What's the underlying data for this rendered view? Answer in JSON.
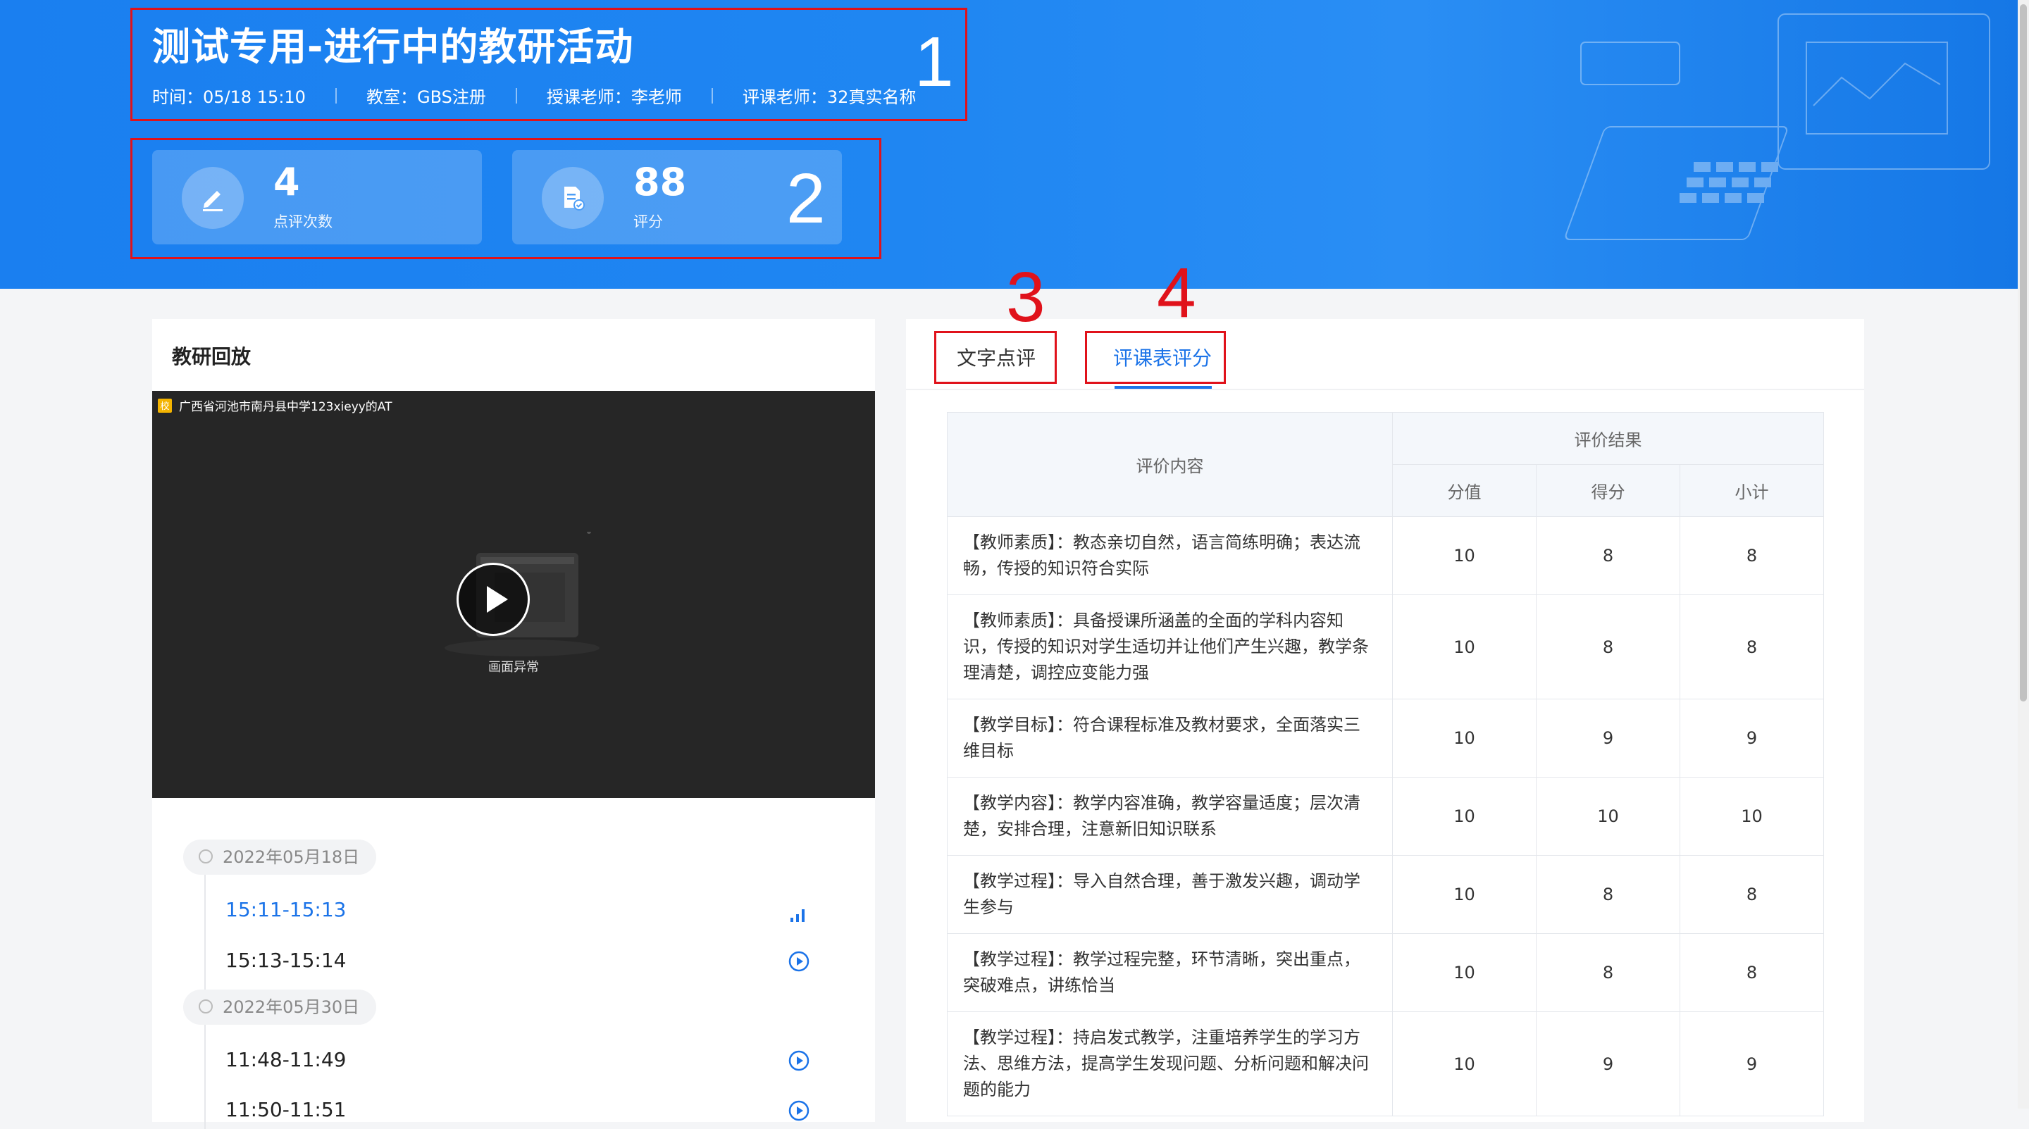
{
  "header": {
    "title": "测试专用-进行中的教研活动",
    "meta": {
      "time": "时间：05/18 15:10",
      "room": "教室：GBS注册",
      "teacher": "授课老师：李老师",
      "reviewer": "评课老师：32真实名称"
    }
  },
  "stats": [
    {
      "value": "4",
      "label": "点评次数",
      "icon": "edit-pen-icon"
    },
    {
      "value": "88",
      "label": "评分",
      "icon": "score-document-icon"
    }
  ],
  "annotations": [
    "1",
    "2",
    "3",
    "4"
  ],
  "replay": {
    "title": "教研回放",
    "video_label": "广西省河池市南丹县中学123xieyy的AT",
    "video_badge": "校",
    "video_status": "画面异常",
    "groups": [
      {
        "date": "2022年05月18日",
        "slots": [
          {
            "time": "15:11-15:13",
            "active": true
          },
          {
            "time": "15:13-15:14",
            "active": false
          }
        ]
      },
      {
        "date": "2022年05月30日",
        "slots": [
          {
            "time": "11:48-11:49",
            "active": false
          },
          {
            "time": "11:50-11:51",
            "active": false
          }
        ]
      }
    ]
  },
  "tabs": {
    "text_review": "文字点评",
    "score_sheet": "评课表评分",
    "active": "score_sheet"
  },
  "table": {
    "head": {
      "content": "评价内容",
      "result": "评价结果",
      "value": "分值",
      "score": "得分",
      "subtotal": "小计"
    },
    "rows": [
      {
        "content": "【教师素质】：教态亲切自然，语言简练明确；表达流畅，传授的知识符合实际",
        "value": "10",
        "score": "8",
        "subtotal": "8"
      },
      {
        "content": "【教师素质】：具备授课所涵盖的全面的学科内容知识，传授的知识对学生适切并让他们产生兴趣，教学条理清楚，调控应变能力强",
        "value": "10",
        "score": "8",
        "subtotal": "8"
      },
      {
        "content": "【教学目标】：符合课程标准及教材要求，全面落实三维目标",
        "value": "10",
        "score": "9",
        "subtotal": "9"
      },
      {
        "content": "【教学内容】：教学内容准确，教学容量适度；层次清楚，安排合理，注意新旧知识联系",
        "value": "10",
        "score": "10",
        "subtotal": "10"
      },
      {
        "content": "【教学过程】：导入自然合理，善于激发兴趣，调动学生参与",
        "value": "10",
        "score": "8",
        "subtotal": "8"
      },
      {
        "content": "【教学过程】：教学过程完整，环节清晰，突出重点，突破难点，讲练恰当",
        "value": "10",
        "score": "8",
        "subtotal": "8"
      },
      {
        "content": "【教学过程】：持启发式教学，注重培养学生的学习方法、思维方法，提高学生发现问题、分析问题和解决问题的能力",
        "value": "10",
        "score": "9",
        "subtotal": "9"
      }
    ]
  },
  "colors": {
    "primary": "#1b73e8",
    "hero": "#1f86f2",
    "annotation": "#e0121b"
  }
}
